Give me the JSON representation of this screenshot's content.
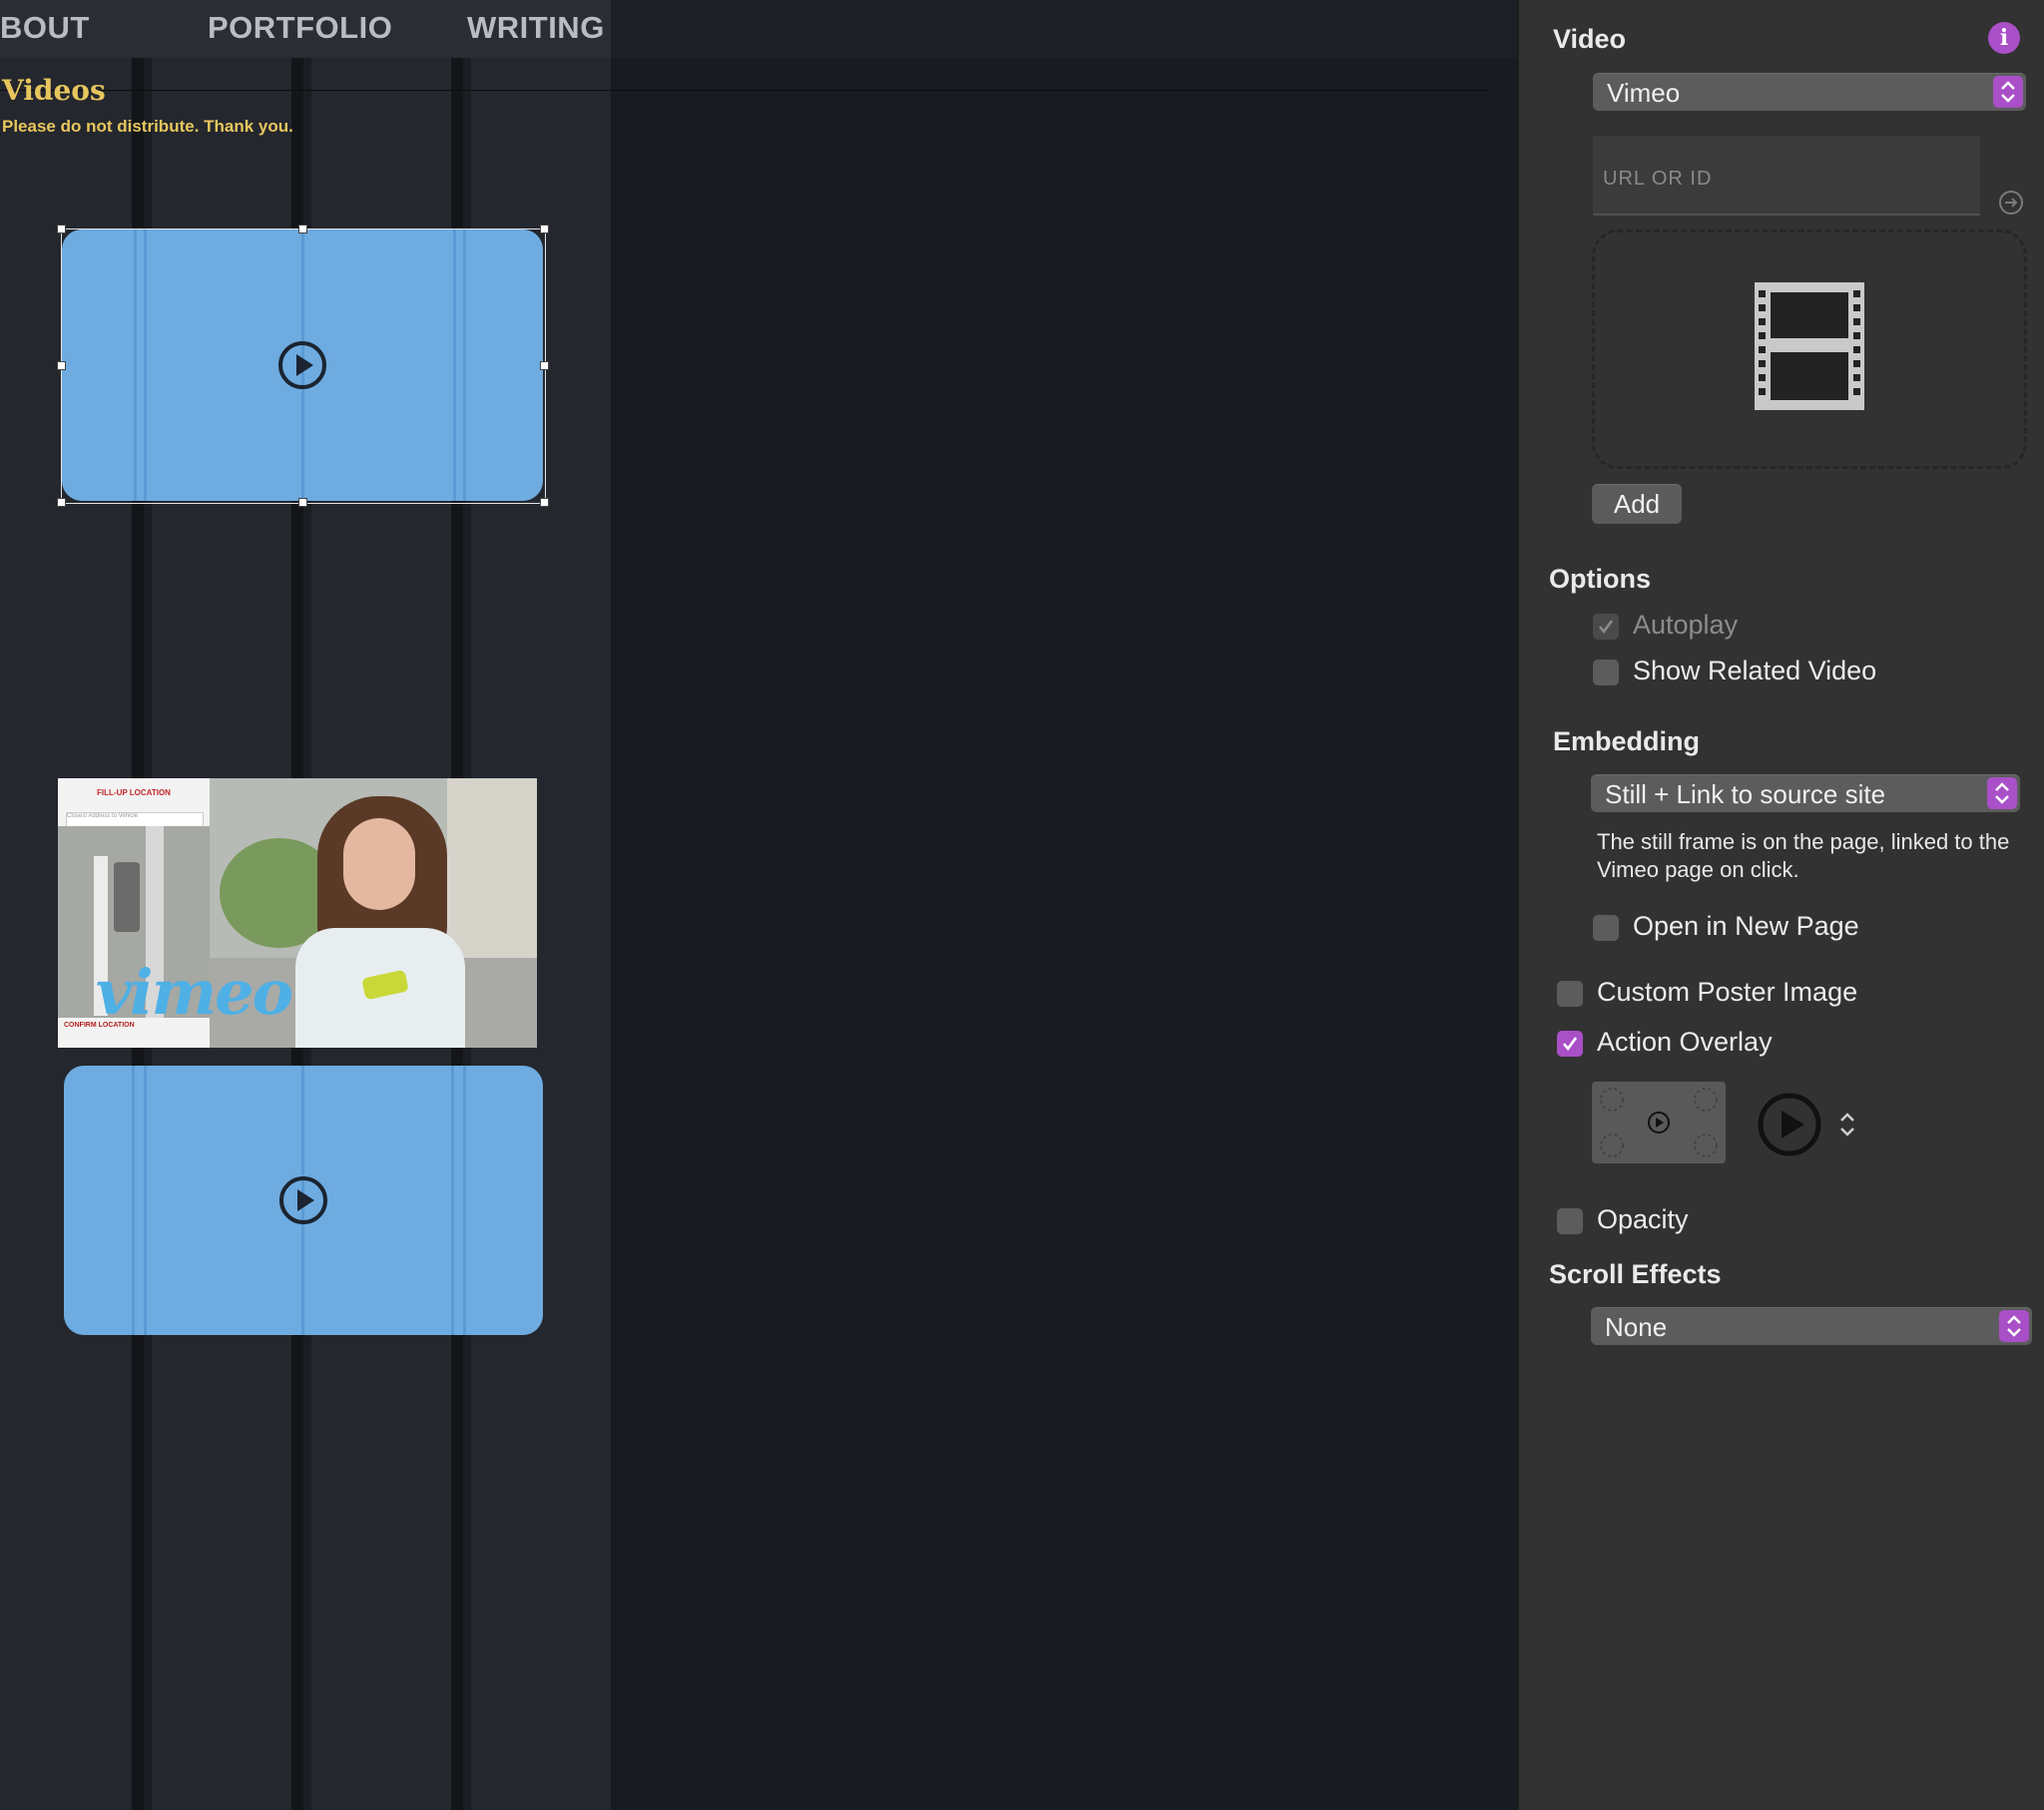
{
  "canvas": {
    "nav": {
      "items": [
        {
          "label": "BOUT"
        },
        {
          "label": "PORTFOLIO"
        },
        {
          "label": "WRITING"
        }
      ]
    },
    "page": {
      "heading": "Videos",
      "subtext": "Please do not distribute. Thank you."
    },
    "still_frame": {
      "brand_text": "vimeo",
      "phone_title": "FILL-UP LOCATION",
      "phone_search_placeholder": "Closest Address to Vehicle",
      "phone_footer": "CONFIRM LOCATION"
    },
    "placeholder_icon": "play-circle-icon"
  },
  "inspector": {
    "video": {
      "title": "Video",
      "info_icon": "info-icon",
      "source_select": "Vimeo",
      "url_placeholder": "URL OR ID",
      "url_value": "",
      "dropzone_icon": "film-strip-icon",
      "add_label": "Add"
    },
    "options": {
      "title": "Options",
      "autoplay": {
        "label": "Autoplay",
        "checked": true,
        "disabled": true
      },
      "show_related": {
        "label": "Show Related Video",
        "checked": false
      }
    },
    "embedding": {
      "title": "Embedding",
      "select": "Still + Link to source site",
      "description": "The still frame is on the page, linked to the Vimeo page on click.",
      "open_new_page": {
        "label": "Open in New Page",
        "checked": false
      }
    },
    "custom_poster": {
      "label": "Custom Poster Image",
      "checked": false
    },
    "action_overlay": {
      "label": "Action Overlay",
      "checked": true
    },
    "opacity": {
      "label": "Opacity",
      "checked": false
    },
    "scroll_effects": {
      "title": "Scroll Effects",
      "select": "None"
    }
  },
  "colors": {
    "accent": "#a94fc7",
    "video_placeholder": "#6eabe0",
    "heading_gold": "#e7c65e",
    "inspector_bg": "#323232",
    "canvas_bg": "#181b21"
  }
}
